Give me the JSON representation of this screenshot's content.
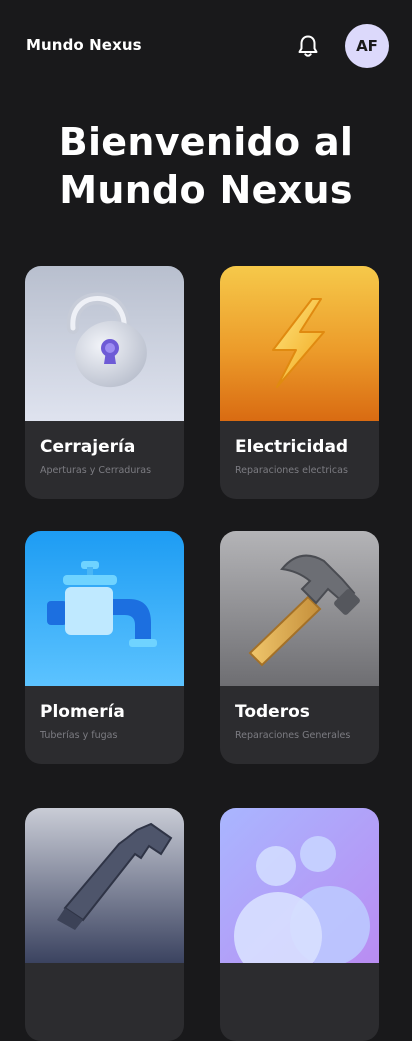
{
  "header": {
    "brand": "Mundo Nexus",
    "avatar_initials": "AF",
    "notification_icon": "bell-icon"
  },
  "hero": {
    "line1": "Bienvenido al",
    "line2": "Mundo Nexus"
  },
  "categories": [
    {
      "title": "Cerrajería",
      "subtitle": "Aperturas y Cerraduras",
      "icon": "padlock-icon"
    },
    {
      "title": "Electricidad",
      "subtitle": "Reparaciones electricas",
      "icon": "lightning-bolt-icon"
    },
    {
      "title": "Plomería",
      "subtitle": "Tuberías y fugas",
      "icon": "faucet-icon"
    },
    {
      "title": "Toderos",
      "subtitle": "Reparaciones Generales",
      "icon": "hammer-icon"
    },
    {
      "title": "",
      "subtitle": "",
      "icon": "wrench-icon"
    },
    {
      "title": "",
      "subtitle": "",
      "icon": "people-icon"
    }
  ],
  "colors": {
    "background": "#19191b",
    "card": "#2c2c2f",
    "avatar": "#dcd9fb"
  }
}
